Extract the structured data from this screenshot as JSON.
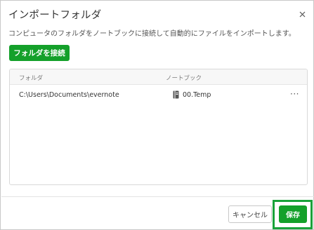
{
  "dialog": {
    "title": "インポートフォルダ",
    "description": "コンピュータのフォルダをノートブックに接続して自動的にファイルをインポートします。"
  },
  "toolbar": {
    "connect_label": "フォルダを接続"
  },
  "table": {
    "columns": [
      "フォルダ",
      "ノートブック"
    ],
    "rows": [
      {
        "folder": "C:\\Users\\Documents\\evernote",
        "notebook": "00.Temp",
        "more": "···"
      }
    ]
  },
  "footer": {
    "cancel_label": "キャンセル",
    "save_label": "保存"
  },
  "colors": {
    "accent": "#14a02a",
    "highlight": "#19a23a"
  },
  "icons": {
    "close": "close-icon",
    "notebook": "notebook-icon"
  }
}
